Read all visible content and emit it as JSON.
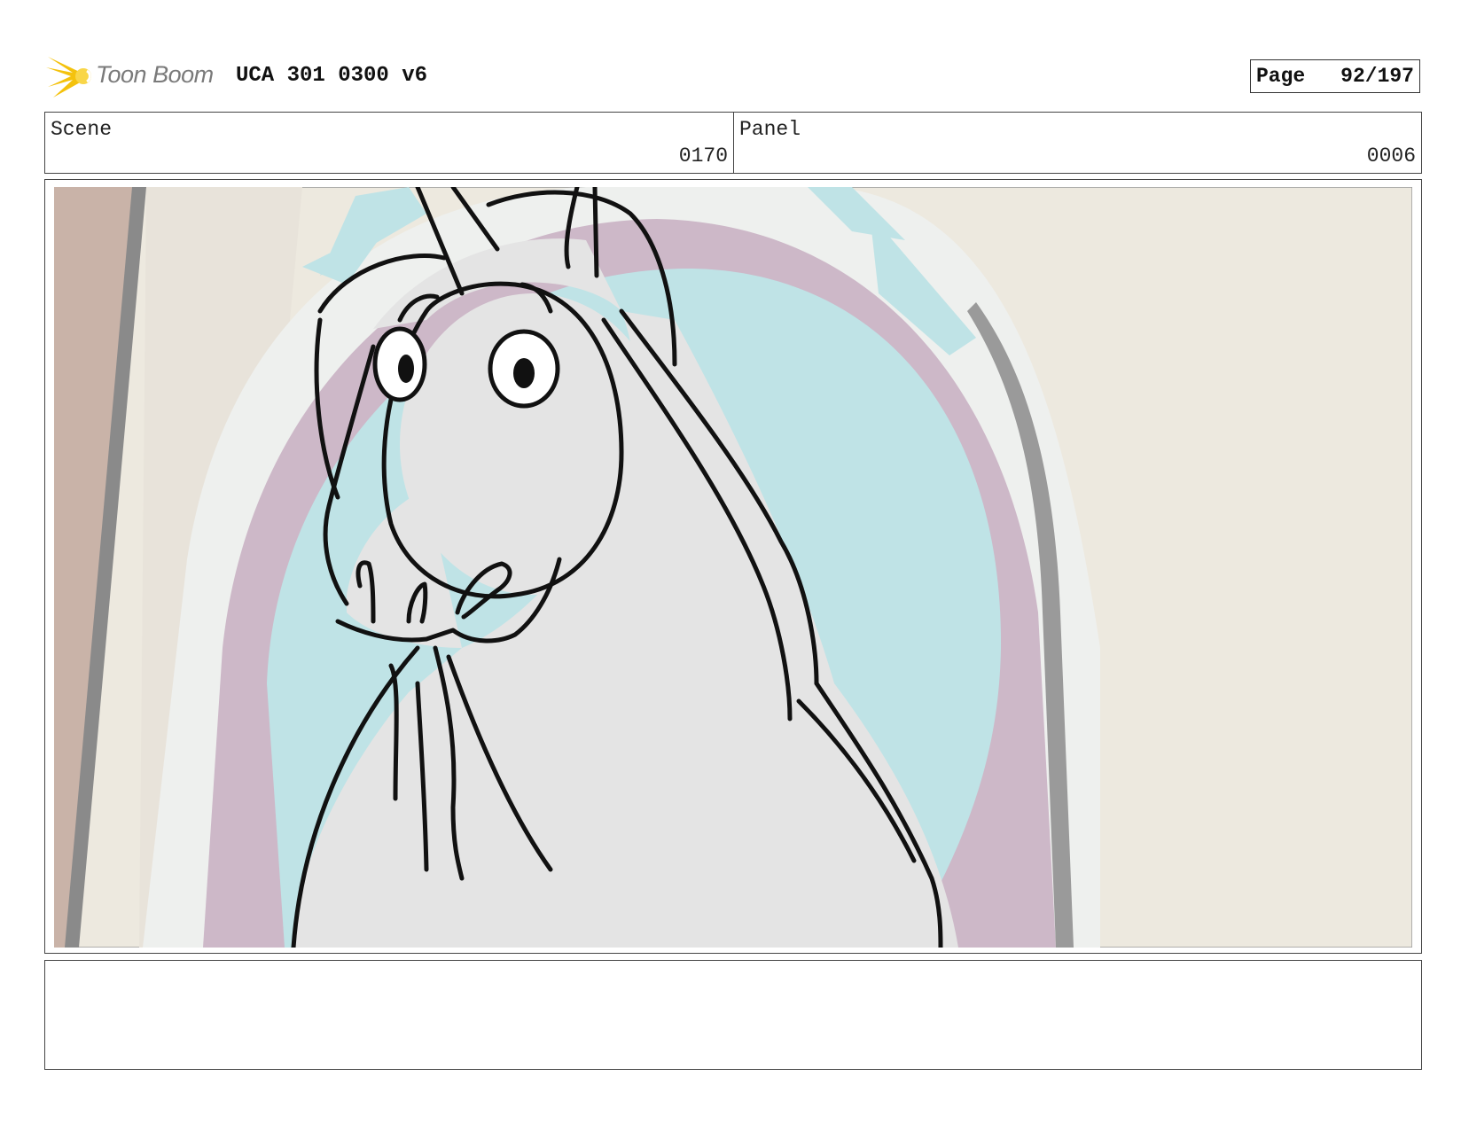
{
  "header": {
    "brand": "Toon Boom",
    "title": "UCA 301 0300 v6",
    "page_label": "Page",
    "page_number": "92/197"
  },
  "info": {
    "scene_label": "Scene",
    "scene_value": "0170",
    "panel_label": "Panel",
    "panel_value": "0006"
  },
  "notes": {
    "text": ""
  },
  "colors": {
    "sky": "#bfe3e6",
    "arch_purple": "#cdb8c8",
    "wall_cream": "#ede9df",
    "pillar_tan": "#c9b3a8",
    "horse_gray": "#e4e4e4",
    "logo_yellow": "#f4c20d"
  }
}
